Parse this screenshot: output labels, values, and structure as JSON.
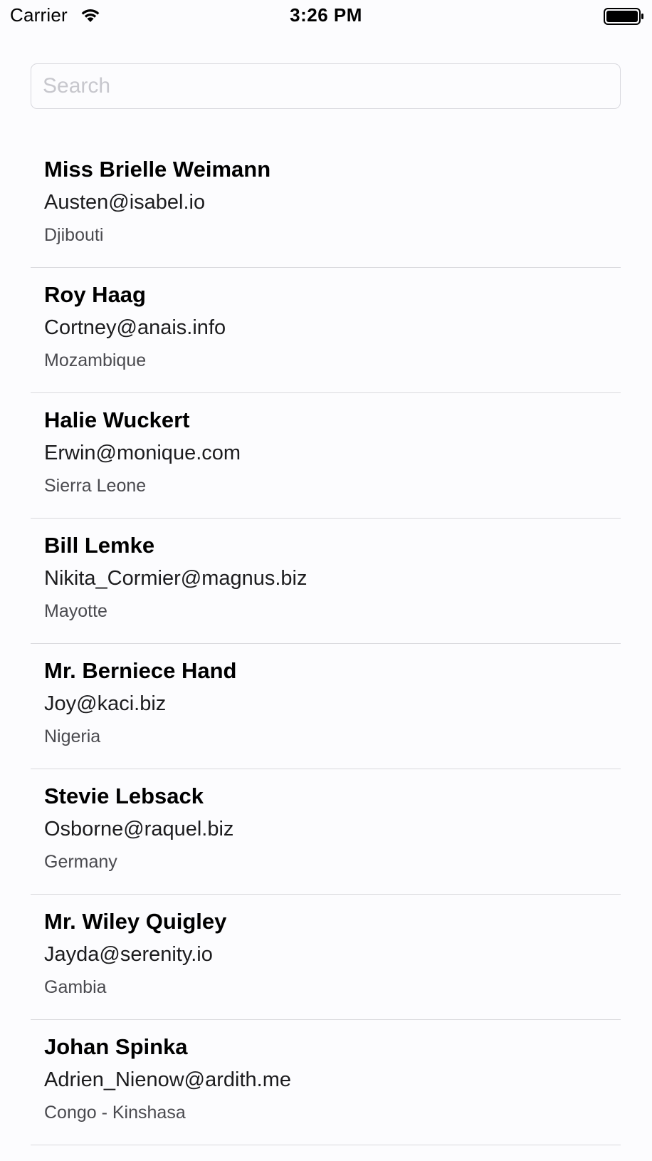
{
  "status_bar": {
    "carrier": "Carrier",
    "time": "3:26 PM",
    "wifi_icon": "wifi-icon",
    "battery_icon": "battery-icon"
  },
  "search": {
    "placeholder": "Search",
    "value": ""
  },
  "contacts": [
    {
      "name": "Miss Brielle Weimann",
      "email": "Austen@isabel.io",
      "country": "Djibouti"
    },
    {
      "name": "Roy Haag",
      "email": "Cortney@anais.info",
      "country": "Mozambique"
    },
    {
      "name": "Halie Wuckert",
      "email": "Erwin@monique.com",
      "country": "Sierra Leone"
    },
    {
      "name": "Bill Lemke",
      "email": "Nikita_Cormier@magnus.biz",
      "country": "Mayotte"
    },
    {
      "name": "Mr. Berniece Hand",
      "email": "Joy@kaci.biz",
      "country": "Nigeria"
    },
    {
      "name": "Stevie Lebsack",
      "email": "Osborne@raquel.biz",
      "country": "Germany"
    },
    {
      "name": "Mr. Wiley Quigley",
      "email": "Jayda@serenity.io",
      "country": "Gambia"
    },
    {
      "name": "Johan Spinka",
      "email": "Adrien_Nienow@ardith.me",
      "country": "Congo - Kinshasa"
    }
  ]
}
